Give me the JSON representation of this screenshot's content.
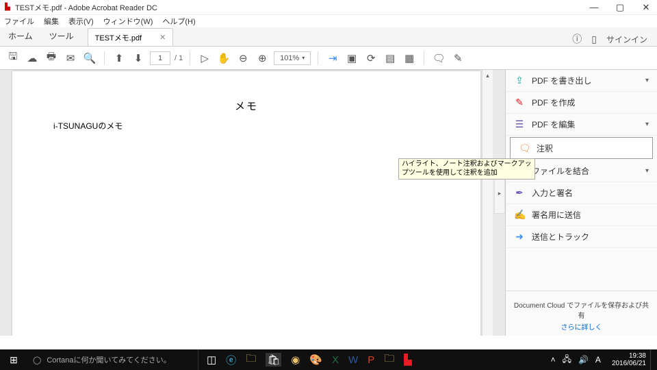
{
  "titlebar": {
    "title": "TESTメモ.pdf - Adobe Acrobat Reader DC"
  },
  "menubar": {
    "file": "ファイル",
    "edit": "編集",
    "view": "表示(V)",
    "window": "ウィンドウ(W)",
    "help": "ヘルプ(H)"
  },
  "tabbar": {
    "home": "ホーム",
    "tools": "ツール",
    "doc_tab": "TESTメモ.pdf",
    "signin": "サインイン"
  },
  "toolbar": {
    "page": "1",
    "page_total": "/ 1",
    "zoom": "101%"
  },
  "document": {
    "heading": "メモ",
    "subtext": "i-TSUNAGUのメモ"
  },
  "tooltip": {
    "text": "ハイライト、ノート注釈およびマークアップツールを使用して注釈を追加"
  },
  "right_pane": {
    "items": [
      {
        "icon": "⇪",
        "label": "PDF を書き出し",
        "color": "icon-teal",
        "chev": true
      },
      {
        "icon": "✎",
        "label": "PDF を作成",
        "color": "icon-red",
        "chev": false
      },
      {
        "icon": "☰",
        "label": "PDF を編集",
        "color": "icon-purple",
        "chev": true
      },
      {
        "icon": "🗨",
        "label": "注釈",
        "color": "icon-orange",
        "chev": false,
        "selected": true
      },
      {
        "icon": "◧",
        "label": "ファイルを結合",
        "color": "icon-blue",
        "chev": true
      },
      {
        "icon": "✒",
        "label": "入力と署名",
        "color": "icon-purple",
        "chev": false
      },
      {
        "icon": "✍",
        "label": "署名用に送信",
        "color": "icon-blue",
        "chev": false
      },
      {
        "icon": "➜",
        "label": "送信とトラック",
        "color": "icon-blue",
        "chev": false
      }
    ],
    "footer_msg": "Document Cloud でファイルを保存および共有",
    "footer_link": "さらに詳しく"
  },
  "taskbar": {
    "search_placeholder": "Cortanaに何か聞いてみてください。",
    "time": "19:38",
    "date": "2016/06/21"
  }
}
